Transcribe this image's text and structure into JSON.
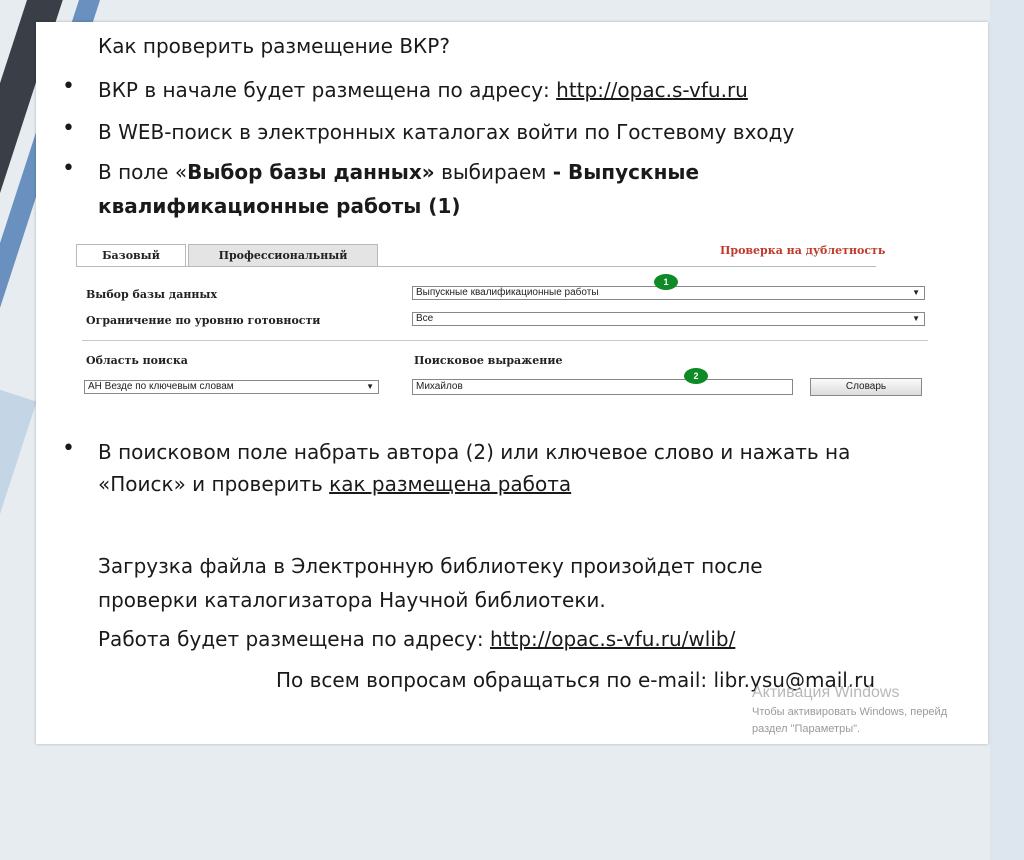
{
  "slide": {
    "heading": "Как проверить размещение ВКР?",
    "bullet_char": "•",
    "b1_text": "ВКР в начале будет размещена по адресу: ",
    "b1_link": "http://opac.s-vfu.ru",
    "b2_text": "В WEB-поиск в электронных каталогах войти по Гостевому входу",
    "b3_pre": "В поле «",
    "b3_bold1": "Выбор базы данных»",
    "b3_mid": "  выбираем ",
    "b3_bold2": "-  Выпускные",
    "b3_line2": "квалификационные работы (1)",
    "b4_line1": "В поисковом  поле набрать автора (2) или ключевое слово и нажать на",
    "b4_line2_pre": "«Поиск» и проверить ",
    "b4_line2_link": "как размещена работа",
    "p1_line1": "Загрузка файла в Электронную библиотеку произойдет после",
    "p1_line2": "проверки каталогизатора Научной библиотеки.",
    "p2_text": "Работа будет размещена по адресу: ",
    "p2_link": "http://opac.s-vfu.ru/wlib/",
    "contact": "По всем вопросам обращаться по e-mail: libr.ysu@mail.ru"
  },
  "opac": {
    "tab_basic": "Базовый",
    "tab_pro": "Профессиональный",
    "duplicate_link": "Проверка на дублетность",
    "db_label": "Выбор базы данных",
    "db_value": "Выпускные квалификационные работы",
    "ready_label": "Ограничение по уровню готовности",
    "ready_value": "Все",
    "area_label": "Область поиска",
    "area_value": "АН Везде по ключевым словам",
    "expr_label": "Поисковое выражение",
    "expr_value": "Михайлов",
    "dict_button": "Словарь",
    "badge1": "1",
    "badge2": "2",
    "arrow": "▼"
  },
  "watermark": {
    "title": "Активация Windows",
    "line1": "Чтобы активировать Windows, перейд",
    "line2": "раздел \"Параметры\"."
  }
}
